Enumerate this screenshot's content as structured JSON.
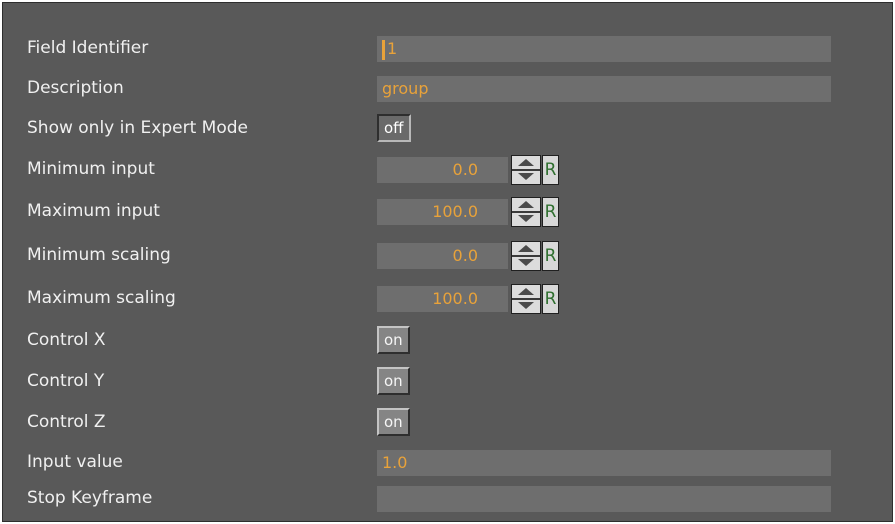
{
  "fields": {
    "field_identifier": {
      "label": "Field Identifier",
      "value": "1"
    },
    "description": {
      "label": "Description",
      "value": "group"
    },
    "expert_mode": {
      "label": "Show only in Expert Mode",
      "state": "off"
    },
    "min_input": {
      "label": "Minimum input",
      "value": "0.0",
      "reset_label": "R"
    },
    "max_input": {
      "label": "Maximum input",
      "value": "100.0",
      "reset_label": "R"
    },
    "min_scaling": {
      "label": "Minimum scaling",
      "value": "0.0",
      "reset_label": "R"
    },
    "max_scaling": {
      "label": "Maximum scaling",
      "value": "100.0",
      "reset_label": "R"
    },
    "control_x": {
      "label": "Control X",
      "state": "on"
    },
    "control_y": {
      "label": "Control Y",
      "state": "on"
    },
    "control_z": {
      "label": "Control Z",
      "state": "on"
    },
    "input_value": {
      "label": "Input value",
      "value": "1.0"
    },
    "stop_keyframe": {
      "label": "Stop Keyframe",
      "value": ""
    }
  },
  "icons": {
    "spinner": "up-down-arrows-icon"
  },
  "colors": {
    "panel_bg": "#595959",
    "field_bg": "#6e6e6e",
    "value_text": "#e8a23a",
    "label_text": "#f0f0f0",
    "reset_text": "#2f6f2f"
  }
}
